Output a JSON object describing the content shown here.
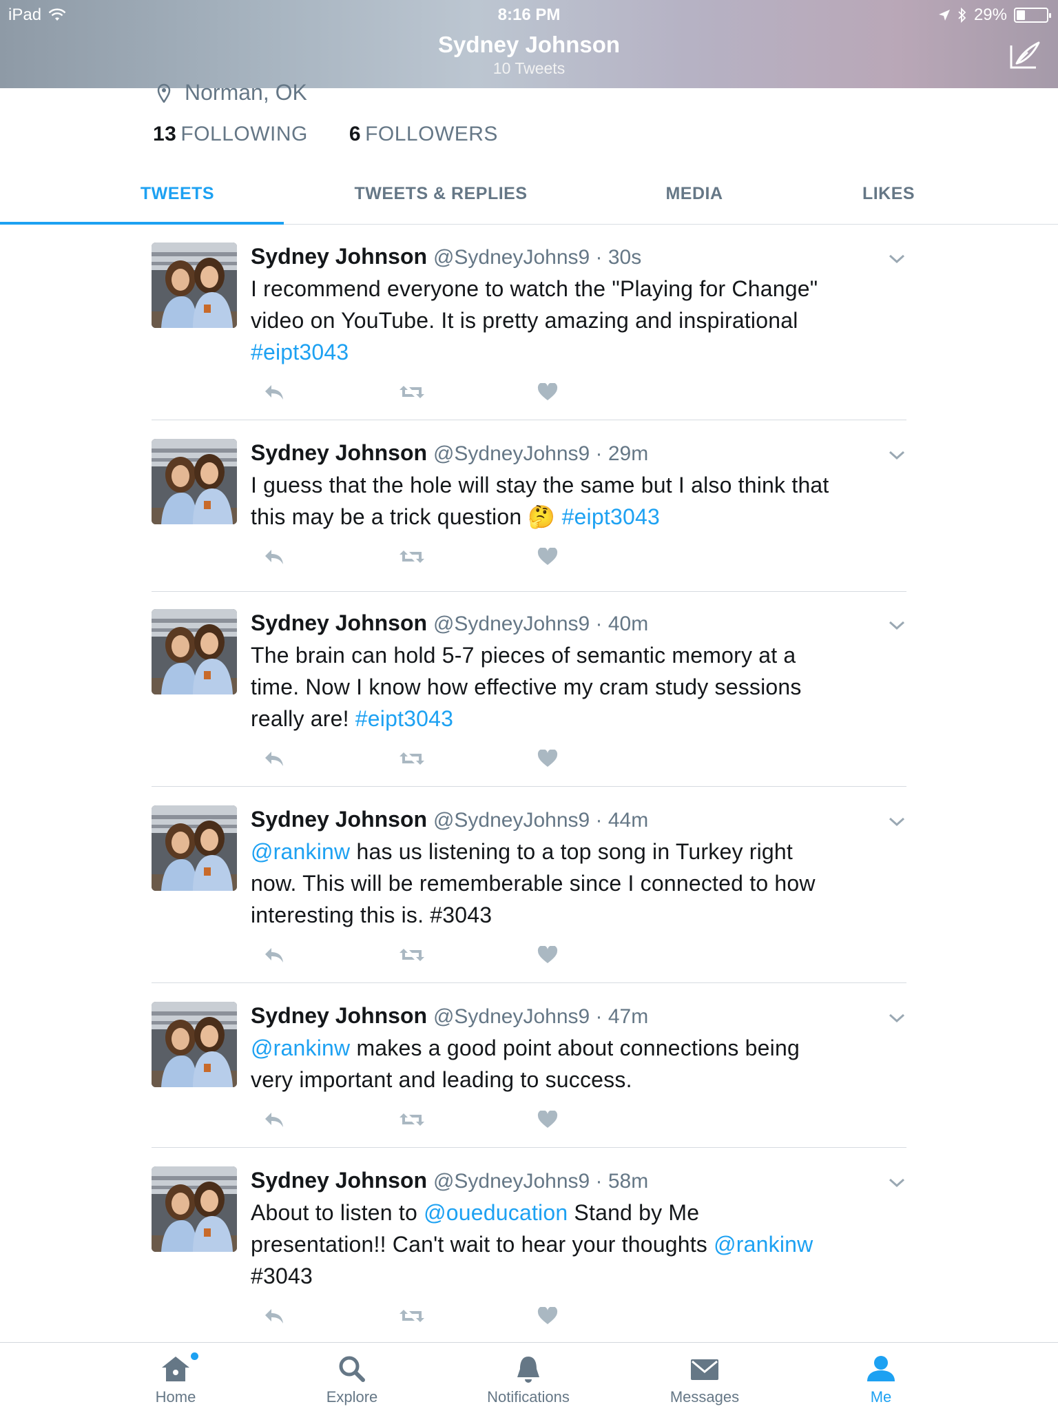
{
  "status_bar": {
    "device": "iPad",
    "time": "8:16 PM",
    "battery": "29%",
    "battery_level": 0.29
  },
  "header": {
    "title": "Sydney Johnson",
    "subtitle": "10 Tweets"
  },
  "profile": {
    "location": "Norman, OK",
    "following_count": "13",
    "following_label": "FOLLOWING",
    "followers_count": "6",
    "followers_label": "FOLLOWERS"
  },
  "tabs": [
    {
      "label": "TWEETS",
      "active": true
    },
    {
      "label": "TWEETS & REPLIES",
      "active": false
    },
    {
      "label": "MEDIA",
      "active": false
    },
    {
      "label": "LIKES",
      "active": false
    }
  ],
  "tweets": [
    {
      "name": "Sydney Johnson",
      "handle": "@SydneyJohns9",
      "time": "30s",
      "lines": [
        [
          {
            "t": "I recommend everyone to watch the \"Playing for Change\""
          }
        ],
        [
          {
            "t": "video on YouTube. It is pretty amazing and inspirational"
          }
        ],
        [
          {
            "t": "#eipt3043",
            "link": true
          }
        ]
      ]
    },
    {
      "name": "Sydney Johnson",
      "handle": "@SydneyJohns9",
      "time": "29m",
      "lines": [
        [
          {
            "t": "I guess that the hole will stay the same but I also think that"
          }
        ],
        [
          {
            "t": "this may be a trick question 🤔  "
          },
          {
            "t": "#eipt3043",
            "link": true
          }
        ]
      ]
    },
    {
      "name": "Sydney Johnson",
      "handle": "@SydneyJohns9",
      "time": "40m",
      "lines": [
        [
          {
            "t": "The brain can hold 5-7 pieces of semantic memory at a"
          }
        ],
        [
          {
            "t": "time. Now I know how effective my cram study sessions"
          }
        ],
        [
          {
            "t": "really are! "
          },
          {
            "t": "#eipt3043",
            "link": true
          }
        ]
      ]
    },
    {
      "name": "Sydney Johnson",
      "handle": "@SydneyJohns9",
      "time": "44m",
      "lines": [
        [
          {
            "t": "@rankinw",
            "link": true
          },
          {
            "t": " has us listening to a top song in Turkey right"
          }
        ],
        [
          {
            "t": "now. This will be rememberable since I connected to how"
          }
        ],
        [
          {
            "t": "interesting this is. #3043"
          }
        ]
      ]
    },
    {
      "name": "Sydney Johnson",
      "handle": "@SydneyJohns9",
      "time": "47m",
      "lines": [
        [
          {
            "t": "@rankinw",
            "link": true
          },
          {
            "t": " makes a good point about connections being"
          }
        ],
        [
          {
            "t": "very important and leading to success."
          }
        ]
      ]
    },
    {
      "name": "Sydney Johnson",
      "handle": "@SydneyJohns9",
      "time": "58m",
      "lines": [
        [
          {
            "t": "About to listen to "
          },
          {
            "t": "@oueducation",
            "link": true
          },
          {
            "t": " Stand by Me"
          }
        ],
        [
          {
            "t": "presentation!! Can't wait to hear your thoughts "
          },
          {
            "t": "@rankinw",
            "link": true
          }
        ],
        [
          {
            "t": "#3043"
          }
        ]
      ]
    }
  ],
  "tabbar": [
    {
      "label": "Home",
      "icon": "home-icon",
      "active": false,
      "badge": true
    },
    {
      "label": "Explore",
      "icon": "search-icon",
      "active": false,
      "badge": false
    },
    {
      "label": "Notifications",
      "icon": "bell-icon",
      "active": false,
      "badge": false
    },
    {
      "label": "Messages",
      "icon": "envelope-icon",
      "active": false,
      "badge": false
    },
    {
      "label": "Me",
      "icon": "person-icon",
      "active": true,
      "badge": false
    }
  ],
  "colors": {
    "accent": "#1da1f2",
    "secondary_text": "#657786",
    "action_icon": "#aab8c2"
  }
}
